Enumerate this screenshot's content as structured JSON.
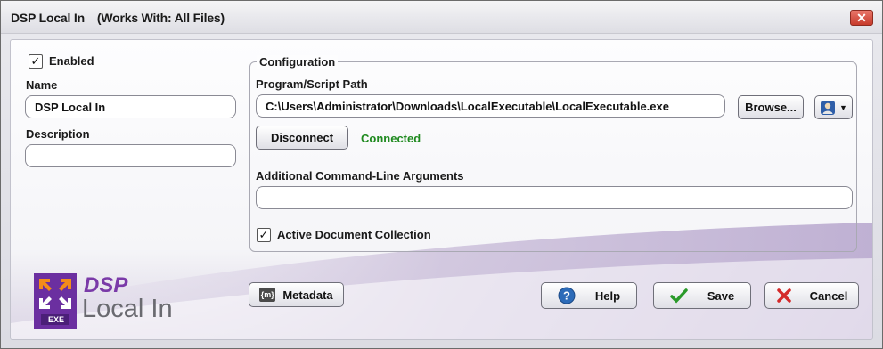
{
  "window": {
    "title": "DSP Local In",
    "subtitle": "(Works With: All Files)",
    "close_icon": "close-icon"
  },
  "left": {
    "enabled_label": "Enabled",
    "enabled_checked": true,
    "name_label": "Name",
    "name_value": "DSP Local In",
    "description_label": "Description",
    "description_value": ""
  },
  "configuration": {
    "group_label": "Configuration",
    "path_label": "Program/Script Path",
    "path_value": "C:\\Users\\Administrator\\Downloads\\LocalExecutable\\LocalExecutable.exe",
    "browse_label": "Browse...",
    "disconnect_label": "Disconnect",
    "status_text": "Connected",
    "args_label": "Additional Command-Line Arguments",
    "args_value": "",
    "adc_label": "Active Document Collection",
    "adc_checked": true
  },
  "logo": {
    "line1": "DSP",
    "line2": "Local In",
    "badge": "EXE"
  },
  "footer": {
    "metadata_label": "Metadata",
    "metadata_icon_text": "{m}",
    "help_label": "Help",
    "save_label": "Save",
    "cancel_label": "Cancel"
  },
  "colors": {
    "brand_purple": "#6b2fa0",
    "connected_green": "#1f8a1f",
    "cancel_red": "#d42a2a",
    "save_green": "#2a9a2a",
    "help_blue": "#2c6bb8"
  }
}
